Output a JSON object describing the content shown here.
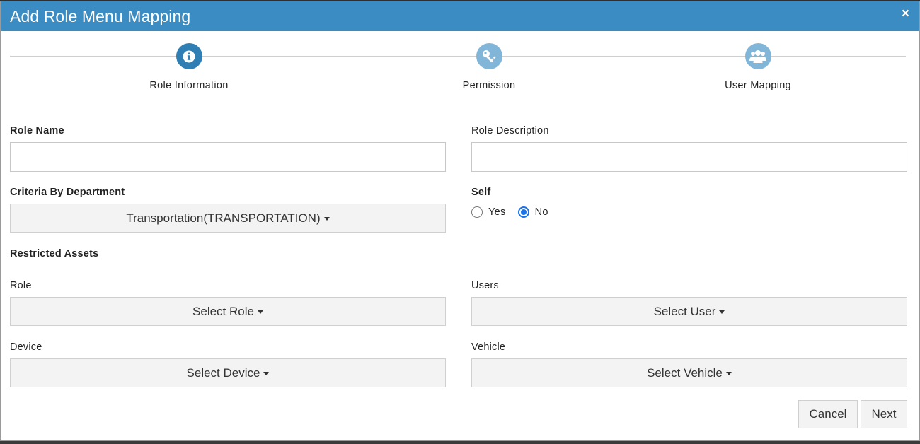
{
  "modal": {
    "title": "Add Role Menu Mapping",
    "close_label": "×"
  },
  "steps": [
    {
      "label": "Role Information",
      "icon": "info-icon",
      "state": "active"
    },
    {
      "label": "Permission",
      "icon": "key-icon",
      "state": "inactive"
    },
    {
      "label": "User Mapping",
      "icon": "users-icon",
      "state": "inactive"
    }
  ],
  "form": {
    "role_name": {
      "label": "Role Name",
      "value": ""
    },
    "role_description": {
      "label": "Role Description",
      "value": ""
    },
    "criteria_department": {
      "label": "Criteria By Department",
      "selected": "Transportation(TRANSPORTATION)"
    },
    "self": {
      "label": "Self",
      "options": [
        {
          "label": "Yes",
          "checked": false
        },
        {
          "label": "No",
          "checked": true
        }
      ]
    },
    "restricted_assets": {
      "heading": "Restricted Assets"
    },
    "role": {
      "label": "Role",
      "selected": "Select Role"
    },
    "users": {
      "label": "Users",
      "selected": "Select User"
    },
    "device": {
      "label": "Device",
      "selected": "Select Device"
    },
    "vehicle": {
      "label": "Vehicle",
      "selected": "Select Vehicle"
    }
  },
  "footer": {
    "cancel_label": "Cancel",
    "next_label": "Next"
  },
  "colors": {
    "header": "#3a8cc2",
    "step_active": "#2f7fb5",
    "step_inactive": "#82b6d8",
    "radio_checked": "#1a73e8"
  }
}
